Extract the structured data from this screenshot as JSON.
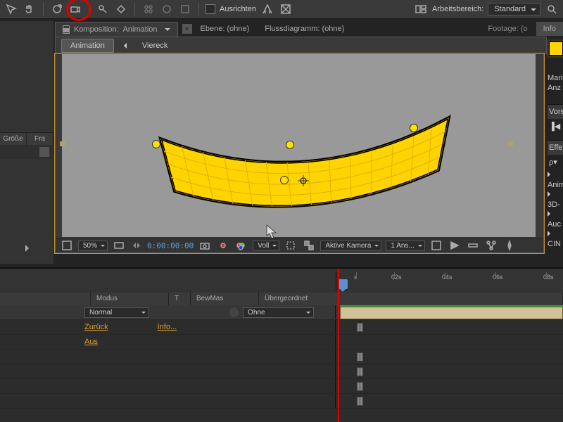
{
  "toolbar": {
    "align_label": "Ausrichten",
    "workspace_label": "Arbeitsbereich:",
    "workspace_value": "Standard"
  },
  "panels": {
    "comp_prefix": "Komposition:",
    "comp_name": "Animation",
    "layer_tab": "Ebene: (ohne)",
    "flow_tab": "Flussdiagramm: (ohne)",
    "footage_tab": "Footage: (o",
    "info_tab": "Info"
  },
  "subtabs": {
    "a": "Animation",
    "b": "Viereck"
  },
  "viewer_footer": {
    "zoom": "50%",
    "timecode": "0:00:00:00",
    "res": "Voll",
    "camera": "Aktive Kamera",
    "views": "1 Ans..."
  },
  "left": {
    "col1": "Größe",
    "col2": "Fra"
  },
  "right": {
    "mario": "Mario",
    "anz": "Anz",
    "vors": "Vors",
    "eff": "Effe",
    "search": "ρ▾",
    "anim": "Anim",
    "d3": "3D-",
    "audio": "Auc",
    "cin": "CIN"
  },
  "timeline": {
    "hdr_mode": "Modus",
    "hdr_t": "T",
    "hdr_bewmas": "BewMas",
    "hdr_parent": "Übergeordnet",
    "mode_value": "Normal",
    "parent_value": "Ohne",
    "link_back": "Zurück",
    "link_info": "Info...",
    "link_off": "Aus",
    "ticks": [
      "s",
      "02s",
      "04s",
      "06s",
      "08s"
    ]
  },
  "chart_data": {
    "type": "table",
    "note": "no chart"
  }
}
